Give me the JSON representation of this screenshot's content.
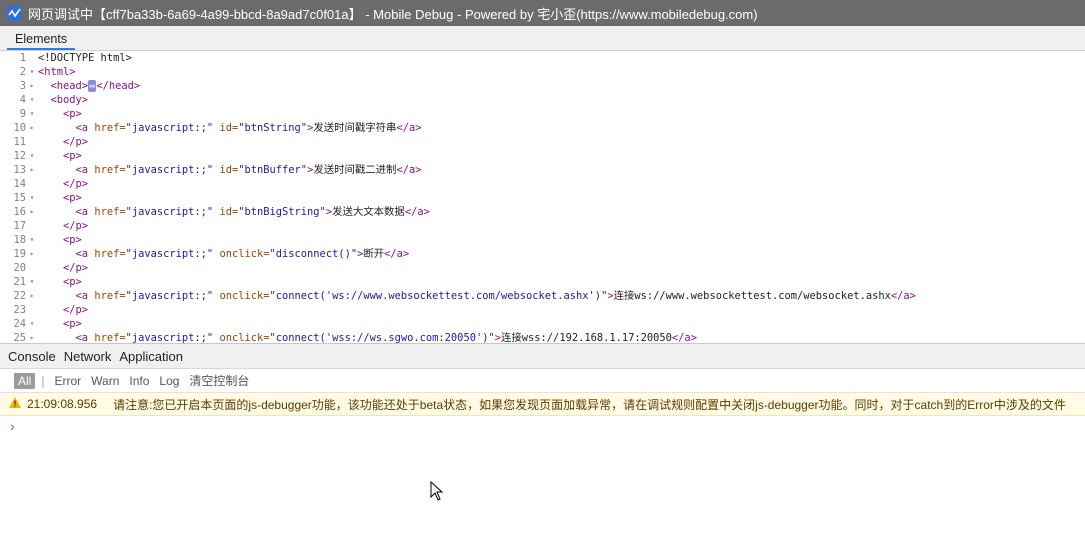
{
  "window": {
    "title": "网页调试中【cff7ba33b-6a69-4a99-bbcd-8a9ad7c0f01a】 - Mobile Debug - Powered by 宅小歪(https://www.mobiledebug.com)"
  },
  "top_tabs": [
    "Elements"
  ],
  "code_lines": [
    {
      "n": "1",
      "a": "",
      "parts": [
        {
          "c": "code",
          "t": "<!DOCTYPE html>"
        }
      ]
    },
    {
      "n": "2",
      "a": "▾",
      "parts": [
        {
          "c": "tag",
          "t": "<html>"
        }
      ]
    },
    {
      "n": "3",
      "a": "▸",
      "parts": [
        {
          "c": "txt",
          "t": "  "
        },
        {
          "c": "tag",
          "t": "<head>"
        },
        {
          "c": "ellip",
          "t": "↔"
        },
        {
          "c": "tag",
          "t": "</head>"
        }
      ]
    },
    {
      "n": "4",
      "a": "▾",
      "parts": [
        {
          "c": "txt",
          "t": "  "
        },
        {
          "c": "tag",
          "t": "<body>"
        }
      ]
    },
    {
      "n": "9",
      "a": "▾",
      "parts": [
        {
          "c": "txt",
          "t": "    "
        },
        {
          "c": "tag",
          "t": "<p>"
        }
      ]
    },
    {
      "n": "10",
      "a": "▸",
      "parts": [
        {
          "c": "txt",
          "t": "      "
        },
        {
          "c": "tag",
          "t": "<a "
        },
        {
          "c": "attr",
          "t": "href="
        },
        {
          "c": "val",
          "t": "\"javascript:;\""
        },
        {
          "c": "attr",
          "t": " id="
        },
        {
          "c": "val",
          "t": "\"btnString\""
        },
        {
          "c": "tag",
          "t": ">"
        },
        {
          "c": "txt",
          "t": "发送时间戳字符串"
        },
        {
          "c": "tag",
          "t": "</a>"
        }
      ]
    },
    {
      "n": "11",
      "a": "",
      "parts": [
        {
          "c": "txt",
          "t": "    "
        },
        {
          "c": "tag",
          "t": "</p>"
        }
      ]
    },
    {
      "n": "12",
      "a": "▾",
      "parts": [
        {
          "c": "txt",
          "t": "    "
        },
        {
          "c": "tag",
          "t": "<p>"
        }
      ]
    },
    {
      "n": "13",
      "a": "▸",
      "parts": [
        {
          "c": "txt",
          "t": "      "
        },
        {
          "c": "tag",
          "t": "<a "
        },
        {
          "c": "attr",
          "t": "href="
        },
        {
          "c": "val",
          "t": "\"javascript:;\""
        },
        {
          "c": "attr",
          "t": " id="
        },
        {
          "c": "val",
          "t": "\"btnBuffer\""
        },
        {
          "c": "tag",
          "t": ">"
        },
        {
          "c": "txt",
          "t": "发送时间戳二进制"
        },
        {
          "c": "tag",
          "t": "</a>"
        }
      ]
    },
    {
      "n": "14",
      "a": "",
      "parts": [
        {
          "c": "txt",
          "t": "    "
        },
        {
          "c": "tag",
          "t": "</p>"
        }
      ]
    },
    {
      "n": "15",
      "a": "▾",
      "parts": [
        {
          "c": "txt",
          "t": "    "
        },
        {
          "c": "tag",
          "t": "<p>"
        }
      ]
    },
    {
      "n": "16",
      "a": "▸",
      "parts": [
        {
          "c": "txt",
          "t": "      "
        },
        {
          "c": "tag",
          "t": "<a "
        },
        {
          "c": "attr",
          "t": "href="
        },
        {
          "c": "val",
          "t": "\"javascript:;\""
        },
        {
          "c": "attr",
          "t": " id="
        },
        {
          "c": "val",
          "t": "\"btnBigString\""
        },
        {
          "c": "tag",
          "t": ">"
        },
        {
          "c": "txt",
          "t": "发送大文本数据"
        },
        {
          "c": "tag",
          "t": "</a>"
        }
      ]
    },
    {
      "n": "17",
      "a": "",
      "parts": [
        {
          "c": "txt",
          "t": "    "
        },
        {
          "c": "tag",
          "t": "</p>"
        }
      ]
    },
    {
      "n": "18",
      "a": "▾",
      "parts": [
        {
          "c": "txt",
          "t": "    "
        },
        {
          "c": "tag",
          "t": "<p>"
        }
      ]
    },
    {
      "n": "19",
      "a": "▸",
      "parts": [
        {
          "c": "txt",
          "t": "      "
        },
        {
          "c": "tag",
          "t": "<a "
        },
        {
          "c": "attr",
          "t": "href="
        },
        {
          "c": "val",
          "t": "\"javascript:;\""
        },
        {
          "c": "attr",
          "t": " onclick="
        },
        {
          "c": "val",
          "t": "\"disconnect()\""
        },
        {
          "c": "tag",
          "t": ">"
        },
        {
          "c": "txt",
          "t": "断开"
        },
        {
          "c": "tag",
          "t": "</a>"
        }
      ]
    },
    {
      "n": "20",
      "a": "",
      "parts": [
        {
          "c": "txt",
          "t": "    "
        },
        {
          "c": "tag",
          "t": "</p>"
        }
      ]
    },
    {
      "n": "21",
      "a": "▾",
      "parts": [
        {
          "c": "txt",
          "t": "    "
        },
        {
          "c": "tag",
          "t": "<p>"
        }
      ]
    },
    {
      "n": "22",
      "a": "▸",
      "parts": [
        {
          "c": "txt",
          "t": "      "
        },
        {
          "c": "tag",
          "t": "<a "
        },
        {
          "c": "attr",
          "t": "href="
        },
        {
          "c": "val",
          "t": "\"javascript:;\""
        },
        {
          "c": "attr",
          "t": " onclick="
        },
        {
          "c": "val",
          "t": "\"connect('ws://www.websockettest.com/websocket.ashx')\""
        },
        {
          "c": "tag",
          "t": ">"
        },
        {
          "c": "txt",
          "t": "连接ws://www.websockettest.com/websocket.ashx"
        },
        {
          "c": "tag",
          "t": "</a>"
        }
      ]
    },
    {
      "n": "23",
      "a": "",
      "parts": [
        {
          "c": "txt",
          "t": "    "
        },
        {
          "c": "tag",
          "t": "</p>"
        }
      ]
    },
    {
      "n": "24",
      "a": "▾",
      "parts": [
        {
          "c": "txt",
          "t": "    "
        },
        {
          "c": "tag",
          "t": "<p>"
        }
      ]
    },
    {
      "n": "25",
      "a": "▸",
      "parts": [
        {
          "c": "txt",
          "t": "      "
        },
        {
          "c": "tag",
          "t": "<a "
        },
        {
          "c": "attr",
          "t": "href="
        },
        {
          "c": "val",
          "t": "\"javascript:;\""
        },
        {
          "c": "attr",
          "t": " onclick="
        },
        {
          "c": "val",
          "t": "\"connect('wss://ws.sgwo.com:20050')\""
        },
        {
          "c": "tag",
          "t": ">"
        },
        {
          "c": "txt",
          "t": "连接wss://192.168.1.17:20050"
        },
        {
          "c": "tag",
          "t": "</a>"
        }
      ]
    }
  ],
  "bottom_tabs": [
    "Console",
    "Network",
    "Application"
  ],
  "filters": {
    "all": "All",
    "separator": "|",
    "error": "Error",
    "warn": "Warn",
    "info": "Info",
    "log": "Log",
    "clear": "清空控制台"
  },
  "log": {
    "time": "21:09:08.956",
    "message": "请注意:您已开启本页面的js-debugger功能，该功能还处于beta状态，如果您发现页面加载异常，请在调试规则配置中关闭js-debugger功能。同时，对于catch到的Error中涉及的文件"
  },
  "prompt": "›",
  "colors": {
    "titlebar": "#6b6b6b",
    "accent": "#3879d9",
    "tag": "#881280",
    "attr": "#994500",
    "value": "#1a1aa6",
    "warn_bg": "#fffbe5"
  }
}
